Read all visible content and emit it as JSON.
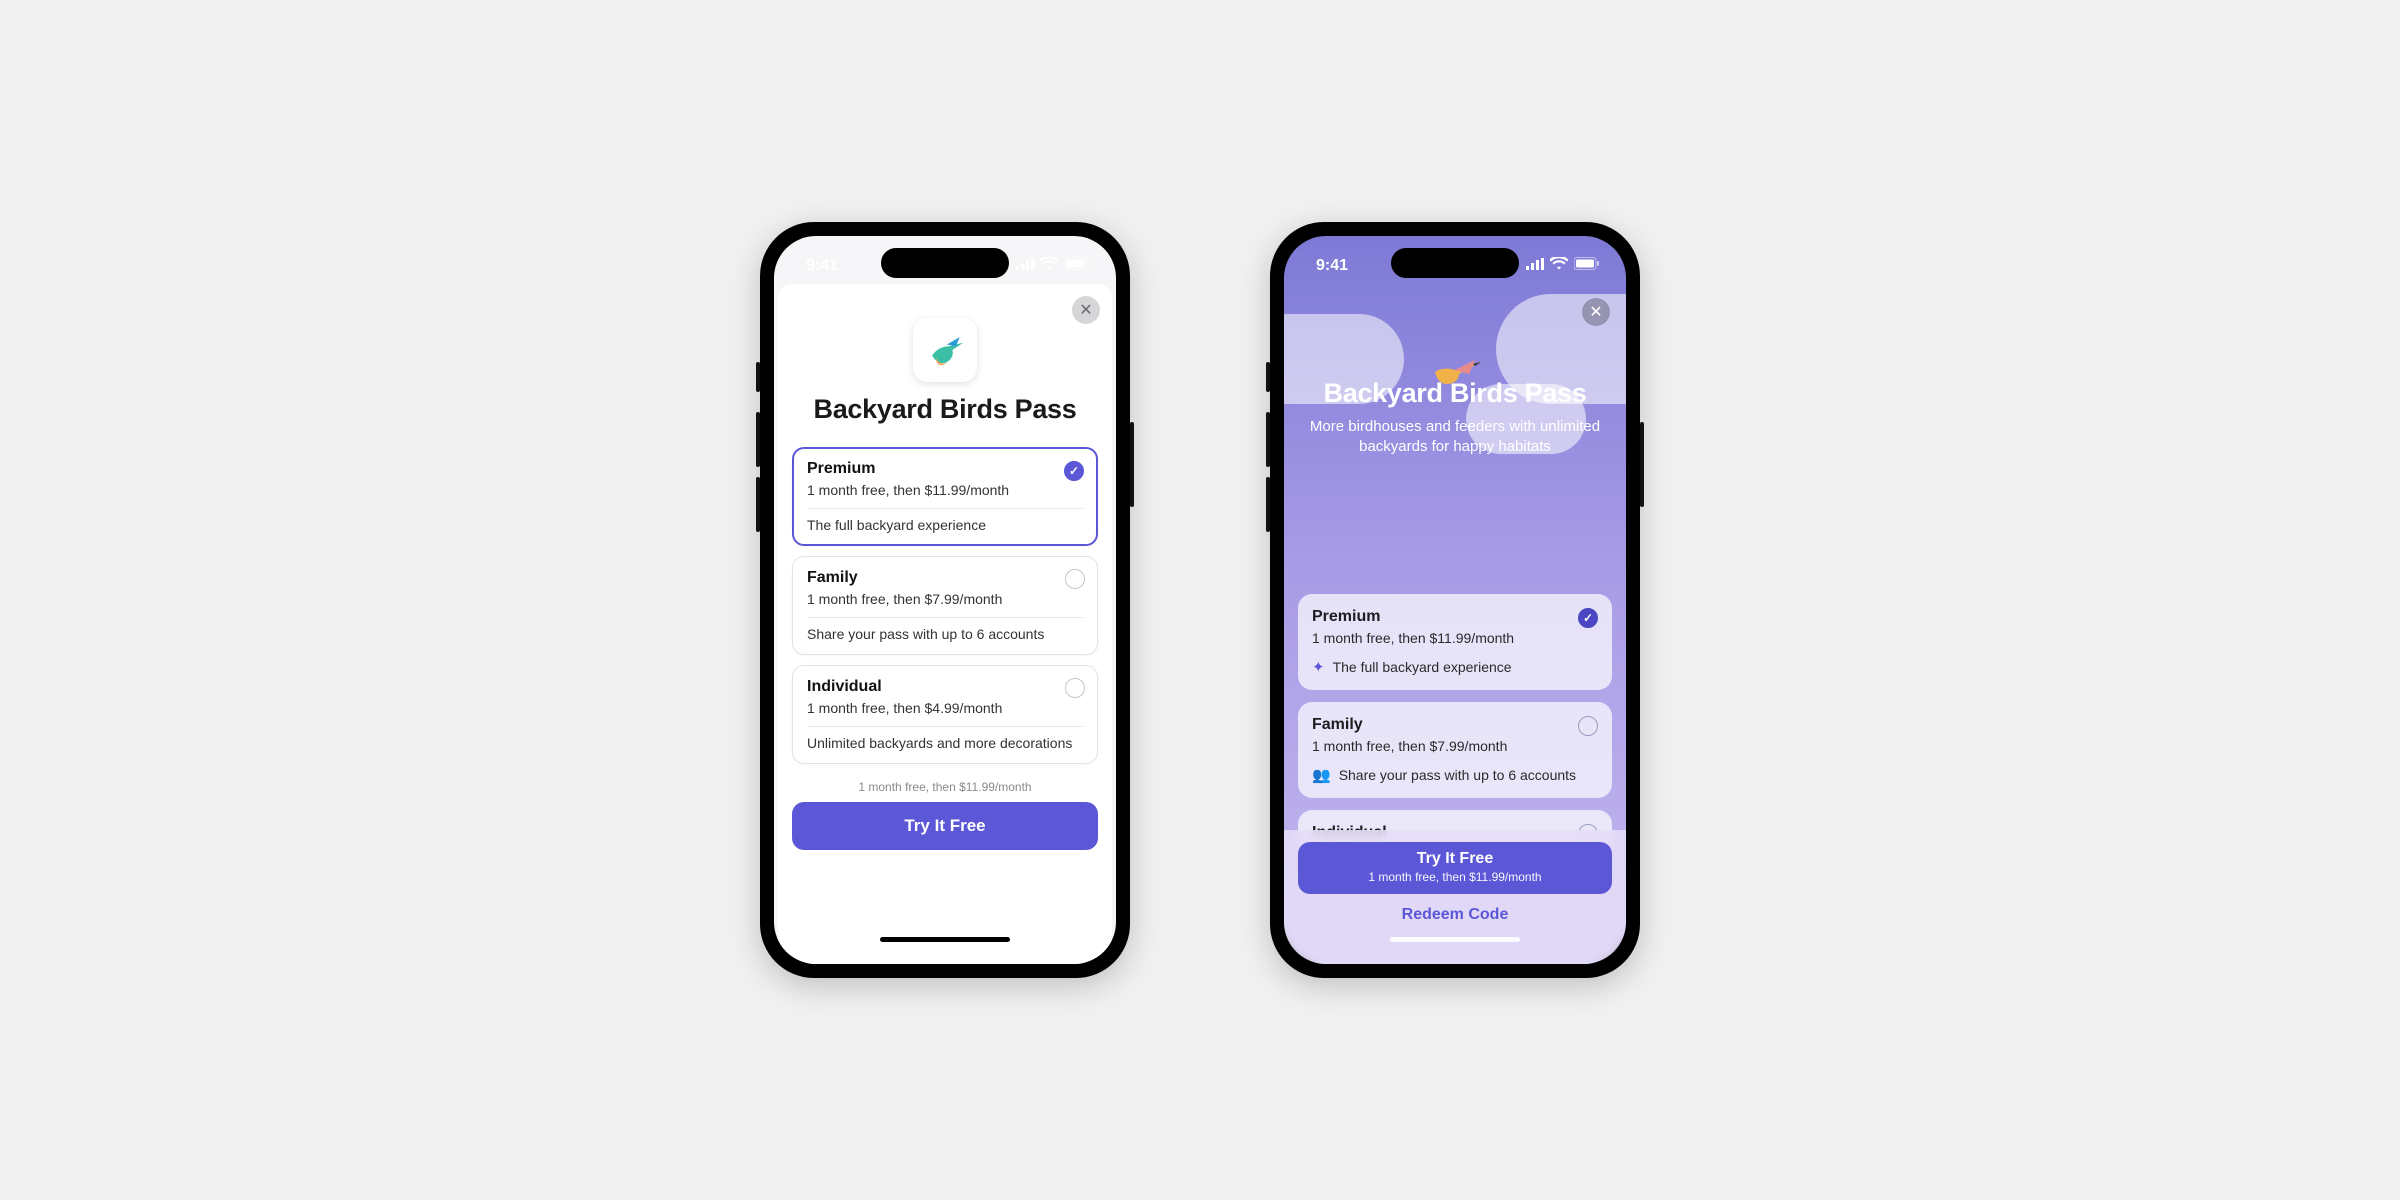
{
  "status": {
    "time": "9:41"
  },
  "shared": {
    "title": "Backyard Birds Pass",
    "close_label": "✕"
  },
  "variantA": {
    "plans": [
      {
        "name": "Premium",
        "price": "1 month free, then $11.99/month",
        "desc": "The full backyard experience",
        "selected": true
      },
      {
        "name": "Family",
        "price": "1 month free, then $7.99/month",
        "desc": "Share your pass with up to 6 accounts",
        "selected": false
      },
      {
        "name": "Individual",
        "price": "1 month free, then $4.99/month",
        "desc": "Unlimited backyards and more decorations",
        "selected": false
      }
    ],
    "cta_subnote": "1 month free, then $11.99/month",
    "cta_label": "Try It Free"
  },
  "variantB": {
    "subtitle": "More birdhouses and feeders with unlimited backyards for happy habitats",
    "plans": [
      {
        "name": "Premium",
        "price": "1 month free, then $11.99/month",
        "desc": "The full backyard experience",
        "selected": true
      },
      {
        "name": "Family",
        "price": "1 month free, then $7.99/month",
        "desc": "Share your pass with up to 6 accounts",
        "selected": false
      },
      {
        "name": "Individual",
        "price": "",
        "desc": "",
        "selected": false
      }
    ],
    "cta_label": "Try It Free",
    "cta_subnote": "1 month free, then $11.99/month",
    "redeem_label": "Redeem Code"
  }
}
